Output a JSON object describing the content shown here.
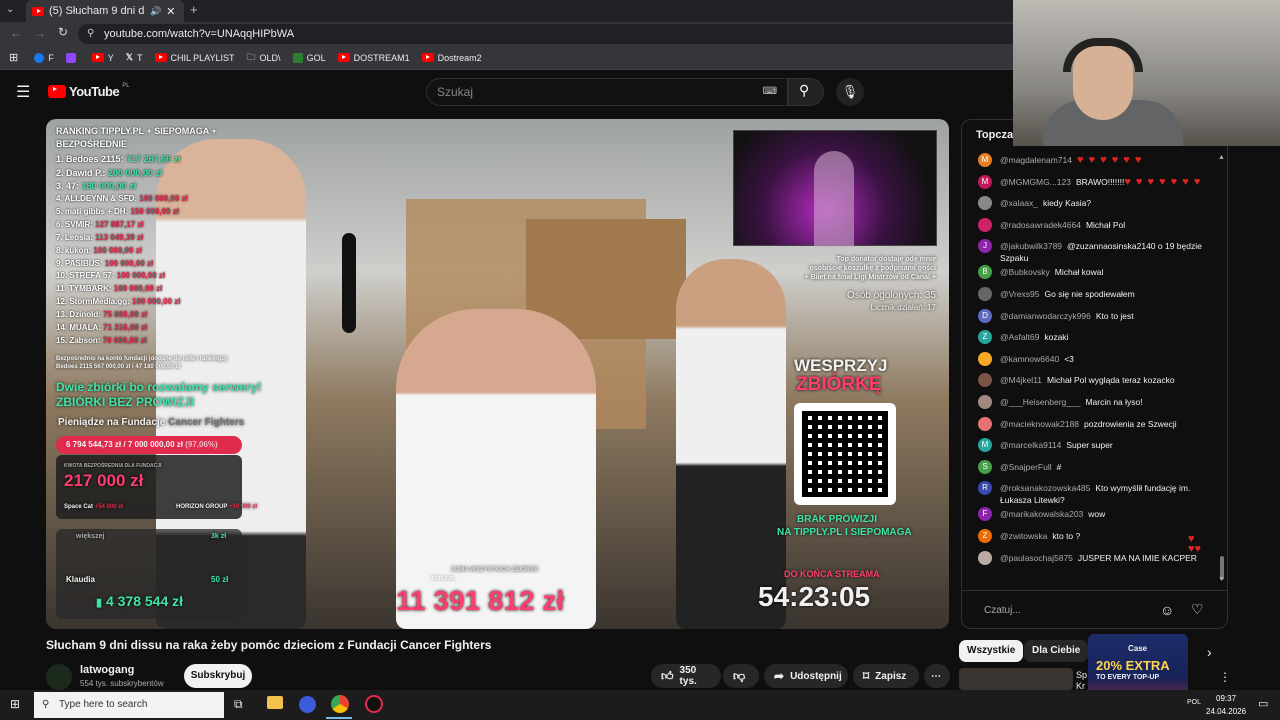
{
  "browser": {
    "tab_title": "(5) Słucham 9 dni dissu na",
    "address": "youtube.com/watch?v=UNAqqHIPbWA",
    "bookmarks": [
      {
        "label": "F",
        "color": "#1877f2"
      },
      {
        "label": "",
        "color": "#9146ff"
      },
      {
        "label": "Y",
        "color": "#ff0000"
      },
      {
        "label": "T",
        "color": "#ffffff"
      },
      {
        "label": "CHIL PLAYLIST",
        "color": "#ff0000"
      },
      {
        "label": "OLD\\",
        "color": "#cccccc"
      },
      {
        "label": "GOL",
        "color": "#2e7d32"
      },
      {
        "label": "DOSTREAM1",
        "color": "#ff0000"
      },
      {
        "label": "Dostream2",
        "color": "#ff0000"
      }
    ]
  },
  "youtube": {
    "logo_text": "YouTube",
    "logo_region": "PL",
    "search_placeholder": "Szukaj"
  },
  "video": {
    "ranking_title": "RANKING TIPPLY.PL + SIEPOMAGA + BEZPOŚREDNIE",
    "ranking": [
      {
        "name": "1. Bedoes 2115:",
        "amount": "717 267,66 zł"
      },
      {
        "name": "2. Dawid P.:",
        "amount": "200 000,00 zł"
      },
      {
        "name": "3. 47:",
        "amount": "180 000,00 zł"
      },
      {
        "name": "4. ALLDEYNN & SFD:",
        "amount": "160 000,00 zł"
      },
      {
        "name": "5. mati gibbs + DH:",
        "amount": "150 000,00 zł"
      },
      {
        "name": "6. SVMIR:",
        "amount": "127 887,17 zł"
      },
      {
        "name": "7. Leosia:",
        "amount": "113 049,39 zł"
      },
      {
        "name": "8. kukon:",
        "amount": "100 000,00 zł"
      },
      {
        "name": "9. PASIBUS:",
        "amount": "100 000,00 zł"
      },
      {
        "name": "10. STREFA 57:",
        "amount": "100 000,00 zł"
      },
      {
        "name": "11. TYMBARK:",
        "amount": "100 000,00 zł"
      },
      {
        "name": "12. StormMedia.gg:",
        "amount": "100 000,00 zł"
      },
      {
        "name": "13. Dzinold:",
        "amount": "75 000,00 zł"
      },
      {
        "name": "14. MUALA:",
        "amount": "71 316,00 zł"
      },
      {
        "name": "15. Zabson:",
        "amount": "70 000,00 zł"
      }
    ],
    "direct_note_1": "Bezpośrednio na konto fundacji (dodane do celu i rankingu)",
    "direct_note_2": "Bedoes 2115  567 000,00 zł i 47  180 000,00 zł",
    "promo_line_1": "Dwie zbiórki bo rozwalamy serwery!",
    "promo_line_2": "ZBIÓRKI BEZ PROWIZJI",
    "foundation_label": "Pieniądze na Fundacje",
    "foundation_name": "Cancer Fighters",
    "progress_text": "6 794 544,73 zł / 7 000 000,00 zł",
    "progress_pct": "(97,06%)",
    "progress_fraction": 0.9706,
    "largest_label": "KWOTA BEZPOŚREDNIA DLA FUNDACJI",
    "largest_amount": "217 000 zł",
    "donor_a": "Space Cat",
    "donor_a_amount": "+54 000 zł",
    "donor_b": "HORIZON GROUP",
    "donor_b_amount": "+50 000 zł",
    "wieksza": "większej",
    "wieksza_val": "3k zł",
    "klaudia_name": "Klaudia",
    "klaudia_small": "50 zł",
    "klaudia_amount": "4 378 544 zł",
    "sum_label": "SUMA WSZYSTKICH ZBIÓREK",
    "sum_amount": "11 391 812 zł",
    "top_donor_1": "Top donator dostaje ode mnie",
    "top_donor_2": "osobiście koszulkę z podpisami gości",
    "top_donor_3": "+ Bilet na finał Ligi Mistrzów od Canal +",
    "people_count": "Osób ogolonych: 35",
    "counter": "Licznik działań: 17",
    "support_1": "WESPRZYJ",
    "support_2": "ZBIÓRKĘ",
    "no_fee_1": "BRAK PROWIZJI",
    "no_fee_2": "NA TIPPLY.PL I SIEPOMAGA",
    "ends_label": "DO KOŃCA STREAMA",
    "countdown": "54:23:05",
    "watermark": "TIPPLY.PL"
  },
  "chat": {
    "title": "Topczat",
    "input_placeholder": "Czatuj...",
    "messages": [
      {
        "author": "@magdalenam714",
        "text": "",
        "hearts": "♥ ♥ ♥ ♥ ♥ ♥",
        "avatar": "M",
        "color": "#e67e22"
      },
      {
        "author": "@MGMGMG...123",
        "text": "BRAWO!!!!!!!",
        "hearts": "♥ ♥ ♥ ♥ ♥ ♥ ♥",
        "avatar": "M",
        "color": "#c2185b"
      },
      {
        "author": "@xalaax_",
        "text": "kiedy Kasia?",
        "hearts": "",
        "avatar": "",
        "color": "#888888"
      },
      {
        "author": "@radosawradek4664",
        "text": "Michał Pol",
        "hearts": "",
        "avatar": "",
        "color": "#c26"
      },
      {
        "author": "@jakubwilk3789",
        "text": "@zuzannaosinska2140 o 19 będzie Szpaku",
        "hearts": "",
        "avatar": "J",
        "color": "#8e24aa"
      },
      {
        "author": "@Bubkovsky",
        "text": "Michał kowal",
        "hearts": "",
        "avatar": "B",
        "color": "#43a047"
      },
      {
        "author": "@Vrexs95",
        "text": "Go się nie spodiewałem",
        "hearts": "",
        "avatar": "",
        "color": "#666666"
      },
      {
        "author": "@damianwodarczyk996",
        "text": "Kto to jest",
        "hearts": "",
        "avatar": "D",
        "color": "#5c6bc0"
      },
      {
        "author": "@Asfalt69",
        "text": "kozaki",
        "hearts": "",
        "avatar": "Z",
        "color": "#26a69a"
      },
      {
        "author": "@kamnow6640",
        "text": "<3",
        "hearts": "",
        "avatar": "",
        "color": "#f9a825"
      },
      {
        "author": "@M4jkel11",
        "text": "Michał Pol wygląda teraz kozacko",
        "hearts": "",
        "avatar": "",
        "color": "#795548"
      },
      {
        "author": "@___Heisenberg___",
        "text": "Marcin na łyso!",
        "hearts": "",
        "avatar": "",
        "color": "#a1887f"
      },
      {
        "author": "@macieknowak2188",
        "text": "pozdrowienia ze Szwecji",
        "hearts": "",
        "avatar": "",
        "color": "#e57373"
      },
      {
        "author": "@marcelka9114",
        "text": "Super super",
        "hearts": "",
        "avatar": "M",
        "color": "#26a69a"
      },
      {
        "author": "@SnajperFull",
        "text": "#",
        "hearts": "",
        "avatar": "S",
        "color": "#43a047"
      },
      {
        "author": "@roksanakozowska485",
        "text": "Kto wymyślił fundację im. Łukasza Litewki?",
        "hearts": "",
        "avatar": "R",
        "color": "#3949ab"
      },
      {
        "author": "@marikakowalska203",
        "text": "wow",
        "hearts": "",
        "avatar": "F",
        "color": "#8e24aa"
      },
      {
        "author": "@zwitowska",
        "text": "kto to ?",
        "hearts": "",
        "avatar": "Z",
        "color": "#ef6c00"
      },
      {
        "author": "@paulasochaj5875",
        "text": "JUSPER MA NA IMIE KACPER",
        "hearts": "",
        "avatar": "",
        "color": "#bcaaa4"
      }
    ]
  },
  "below": {
    "title": "Słucham 9 dni dissu na raka żeby pomóc dzieciom z Fundacji Cancer Fighters",
    "channel": "latwogang",
    "subs": "554 tys. subskrybentów",
    "subscribe": "Subskrybuj",
    "likes": "350 tys.",
    "share": "Udostępnij",
    "save": "Zapisz",
    "chip_all": "Wszystkie",
    "chip_foryou": "Dla Ciebie",
    "ad_brand": "Case",
    "ad_line1": "20% EXTRA",
    "ad_line2": "TO EVERY TOP-UP"
  },
  "taskbar": {
    "search_placeholder": "Type here to search",
    "time": "09:37",
    "date": "24.04.2026",
    "lang": "POL"
  }
}
